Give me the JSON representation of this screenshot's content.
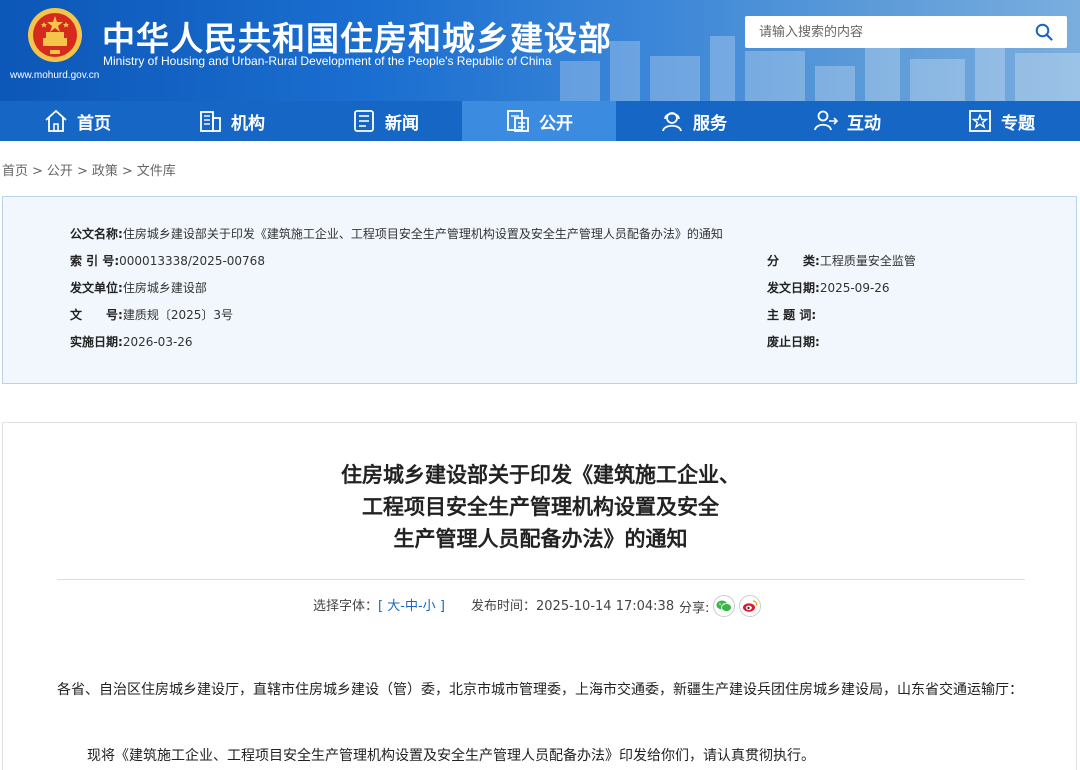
{
  "header": {
    "site_url": "www.mohurd.gov.cn",
    "title_cn": "中华人民共和国住房和城乡建设部",
    "title_en": "Ministry of Housing and Urban-Rural Development of the People's Republic of China",
    "search_placeholder": "请输入搜索的内容",
    "search_icon": "search-icon",
    "colors": {
      "header_blue": "#0c57b8",
      "nav_blue": "#1566c5",
      "nav_active": "#3b8ce0",
      "emblem_red": "#d62a1e",
      "emblem_gold": "#f3c54a"
    }
  },
  "nav": [
    {
      "label": "首页",
      "icon": "home-icon"
    },
    {
      "label": "机构",
      "icon": "building-icon"
    },
    {
      "label": "新闻",
      "icon": "news-icon"
    },
    {
      "label": "公开",
      "icon": "document-icon",
      "active": true
    },
    {
      "label": "服务",
      "icon": "service-icon"
    },
    {
      "label": "互动",
      "icon": "interact-icon"
    },
    {
      "label": "专题",
      "icon": "star-icon"
    }
  ],
  "breadcrumb": [
    "首页",
    "公开",
    "政策",
    "文件库"
  ],
  "info": {
    "title_key": "公文名称:",
    "title_val": "住房城乡建设部关于印发《建筑施工企业、工程项目安全生产管理机构设置及安全生产管理人员配备办法》的通知",
    "index_key": "索 引 号:",
    "index_val": "000013338/2025-00768",
    "category_key": "分　　类:",
    "category_val": "工程质量安全监管",
    "issuer_key": "发文单位:",
    "issuer_val": "住房城乡建设部",
    "issue_date_key": "发文日期:",
    "issue_date_val": "2025-09-26",
    "docno_key": "文　　号:",
    "docno_val": "建质规〔2025〕3号",
    "subject_key": "主 题 词:",
    "subject_val": "",
    "effective_key": "实施日期:",
    "effective_val": "2026-03-26",
    "expiry_key": "废止日期:",
    "expiry_val": ""
  },
  "article": {
    "title_line1": "住房城乡建设部关于印发《建筑施工企业、",
    "title_line2": "工程项目安全生产管理机构设置及安全",
    "title_line3": "生产管理人员配备办法》的通知",
    "font_label": "选择字体：",
    "font_open": "[",
    "font_large": "大",
    "font_medium": "中",
    "font_small": "小",
    "font_dash": "-",
    "font_close": "]",
    "pub_label": "发布时间：",
    "pub_time": "2025-10-14 17:04:38",
    "share_label": "分享:",
    "paragraph1": "各省、自治区住房城乡建设厅，直辖市住房城乡建设（管）委，北京市城市管理委，上海市交通委，新疆生产建设兵团住房城乡建设局，山东省交通运输厅：",
    "paragraph2": "现将《建筑施工企业、工程项目安全生产管理机构设置及安全生产管理人员配备办法》印发给你们，请认真贯彻执行。"
  }
}
